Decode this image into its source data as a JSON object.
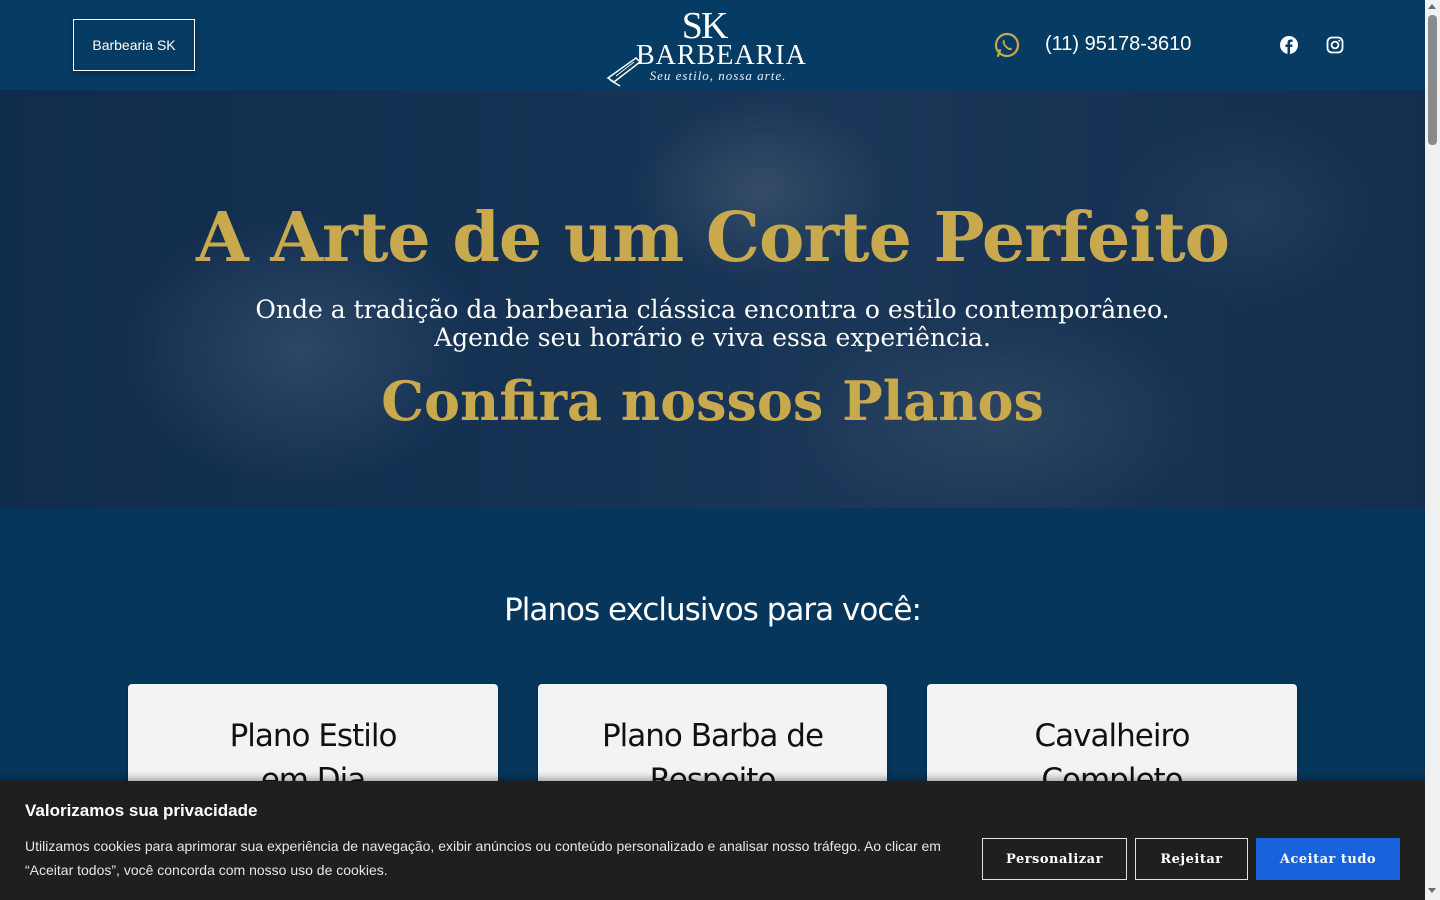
{
  "header": {
    "brand_button": "Barbearia SK",
    "logo": {
      "initials": "SK",
      "name": "BARBEARIA",
      "slogan": "Seu estilo, nossa arte."
    },
    "phone": "(11) 95178-3610",
    "icons": {
      "whatsapp": "whatsapp-icon",
      "facebook": "facebook-icon",
      "instagram": "instagram-icon"
    }
  },
  "hero": {
    "title": "A Arte de um Corte Perfeito",
    "subtitle_line1": "Onde a tradição da barbearia clássica encontra o estilo contemporâneo.",
    "subtitle_line2": "Agende seu horário e viva essa experiência.",
    "plans_heading": "Confira nossos Planos"
  },
  "plans": {
    "title": "Planos exclusivos para você:",
    "cards": [
      {
        "title_line1": "Plano Estilo",
        "title_line2": "em Dia"
      },
      {
        "title_line1": "Plano Barba de",
        "title_line2": "Respeito"
      },
      {
        "title_line1": "Cavalheiro",
        "title_line2": "Completo"
      }
    ]
  },
  "cookie": {
    "title": "Valorizamos sua privacidade",
    "text": "Utilizamos cookies para aprimorar sua experiência de navegação, exibir anúncios ou conteúdo personalizado e analisar nosso tráfego. Ao clicar em “Aceitar todos”, você concorda com nosso uso de cookies.",
    "buttons": {
      "customize": "Personalizar",
      "reject": "Rejeitar",
      "accept": "Aceitar tudo"
    }
  },
  "colors": {
    "header_bg": "#063c63",
    "gold": "#c9a94e",
    "accept_blue": "#1863dc",
    "whatsapp_gold": "#c9a94e"
  }
}
